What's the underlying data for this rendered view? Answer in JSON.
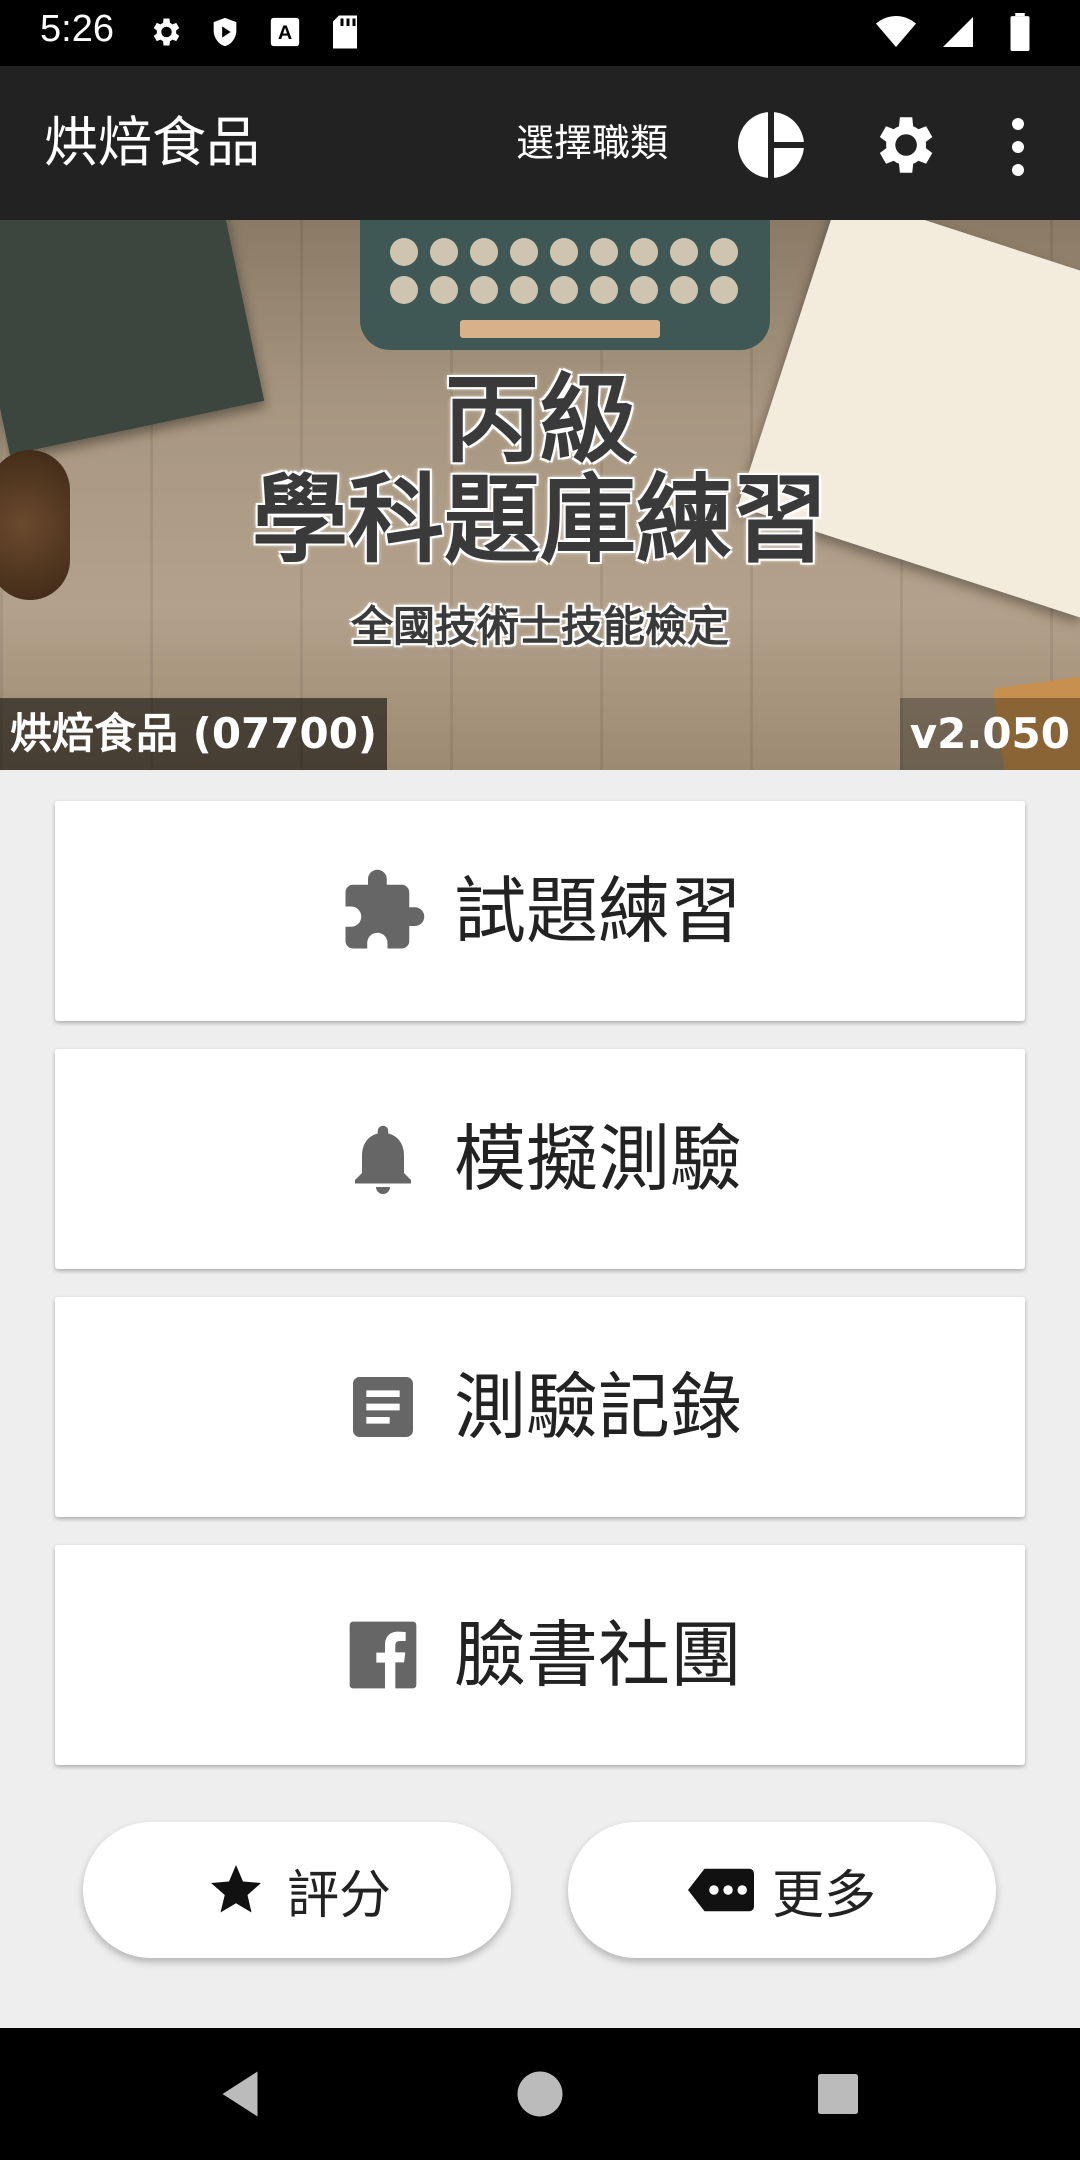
{
  "status_bar": {
    "time": "5:26",
    "icons": [
      "settings-icon",
      "shield-icon",
      "keyboard-a-icon",
      "sd-card-icon",
      "wifi-icon",
      "signal-icon",
      "battery-icon"
    ]
  },
  "app_bar": {
    "title": "烘焙食品",
    "select_job_label": "選擇職類",
    "icons": [
      "pie-chart-icon",
      "gear-icon",
      "more-vert-icon"
    ]
  },
  "banner": {
    "title_line1": "丙級",
    "title_line2": "學科題庫練習",
    "subtitle": "全國技術士技能檢定",
    "category_label": "烘焙食品 (07700)",
    "version": "v2.050"
  },
  "menu": {
    "items": [
      {
        "label": "試題練習",
        "icon": "puzzle-icon"
      },
      {
        "label": "模擬測驗",
        "icon": "bell-icon"
      },
      {
        "label": "測驗記錄",
        "icon": "document-icon"
      },
      {
        "label": "臉書社團",
        "icon": "facebook-icon"
      }
    ]
  },
  "bottom_actions": {
    "rate_label": "評分",
    "more_label": "更多"
  },
  "colors": {
    "app_bar": "#222222",
    "background": "#eeeeee",
    "icon_gray": "#666666"
  }
}
